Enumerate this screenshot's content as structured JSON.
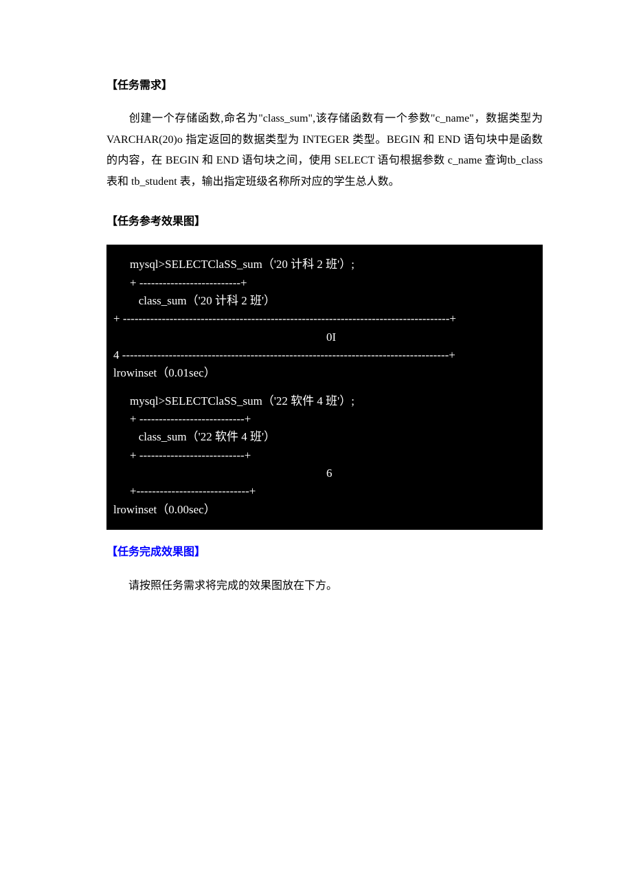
{
  "sections": {
    "req_heading": "【任务需求】",
    "req_body": "创建一个存储函数,命名为\"class_sum\",该存储函数有一个参数\"c_name\"，数据类型为 VARCHAR(20)o 指定返回的数据类型为 INTEGER 类型。BEGIN 和 END 语句块中是函数的内容，在 BEGIN 和 END 语句块之间，使用 SELECT 语句根据参数 c_name 查询tb_class 表和 tb_student 表，输出指定班级名称所对应的学生总人数。",
    "ref_heading": "【任务参考效果图】",
    "done_heading": "【任务完成效果图】",
    "done_body": "请按照任务需求将完成的效果图放在下方。"
  },
  "terminal": {
    "q1_cmd": "mysql>SELECTClaSS_sum（'20 计科 2 班'）;",
    "q1_sep1": "+ --------------------------+",
    "q1_header": "   class_sum（'20 计科 2 班'）",
    "q1_sep2": "+ ------------------------------------------------------------------------------------+",
    "q1_value": "0I",
    "q1_sep3": "4 ------------------------------------------------------------------------------------+",
    "q1_rows": "lrowinset（0.01sec）",
    "q2_cmd": "mysql>SELECTClaSS_sum（'22 软件 4 班'）;",
    "q2_sep1": "+ ---------------------------+",
    "q2_header": "   class_sum（'22 软件 4 班'）",
    "q2_sep2": "+ ---------------------------+",
    "q2_value": "6",
    "q2_sep3": "+-----------------------------+",
    "q2_rows": "lrowinset（0.00sec）"
  }
}
